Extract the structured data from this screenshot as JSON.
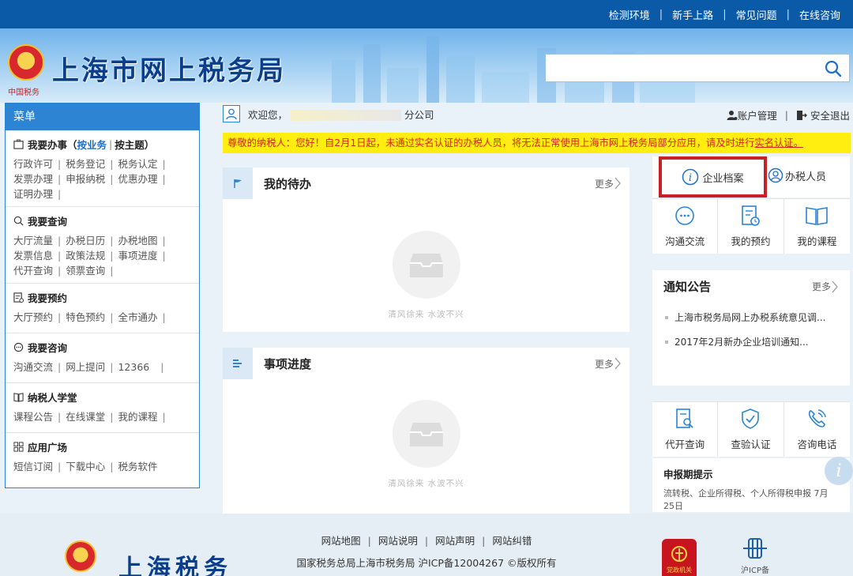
{
  "topnav": {
    "items": [
      "检测环境",
      "新手上路",
      "常见问题",
      "在线咨询"
    ]
  },
  "header": {
    "title": "上海市网上税务局",
    "emblem_text": "中国税务"
  },
  "sidebar": {
    "menu_title": "菜单",
    "sections": [
      {
        "title": "我要办事",
        "title_extra_a": "按业务",
        "title_extra_b": "按主题",
        "rows": [
          [
            "行政许可",
            "税务登记",
            "税务认定"
          ],
          [
            "发票办理",
            "申报纳税",
            "优惠办理"
          ],
          [
            "证明办理"
          ]
        ]
      },
      {
        "title": "我要查询",
        "rows": [
          [
            "大厅流量",
            "办税日历",
            "办税地图"
          ],
          [
            "发票信息",
            "政策法规",
            "事项进度"
          ],
          [
            "代开查询",
            "领票查询"
          ]
        ]
      },
      {
        "title": "我要预约",
        "rows": [
          [
            "大厅预约",
            "特色预约",
            "全市通办"
          ]
        ]
      },
      {
        "title": "我要咨询",
        "rows": [
          [
            "沟通交流",
            "网上提问",
            "12366"
          ]
        ]
      },
      {
        "title": "纳税人学堂",
        "rows": [
          [
            "课程公告",
            "在线课堂",
            "我的课程"
          ]
        ]
      },
      {
        "title": "应用广场",
        "rows": [
          [
            "短信订阅",
            "下载中心",
            "税务软件"
          ]
        ]
      }
    ]
  },
  "welcome": {
    "prefix": "欢迎您，",
    "company_suffix": "分公司",
    "account": "账户管理",
    "logout": "安全退出"
  },
  "notice_bar": {
    "text": "尊敬的纳税人：您好！自2月1日起，未通过实名认证的办税人员，将无法正常使用上海市网上税务局部分应用，请及时进行",
    "link": "实名认证。"
  },
  "todo": {
    "title": "我的待办",
    "more": "更多",
    "empty": "清风徐来  水波不兴"
  },
  "progress": {
    "title": "事项进度",
    "more": "更多",
    "empty": "清风徐来  水波不兴"
  },
  "tabs": {
    "active": "企业档案",
    "other": "办税人员"
  },
  "quick": [
    {
      "label": "沟通交流",
      "icon": "chat-icon"
    },
    {
      "label": "我的预约",
      "icon": "appointment-icon"
    },
    {
      "label": "我的课程",
      "icon": "book-icon"
    }
  ],
  "announce": {
    "title": "通知公告",
    "more": "更多",
    "items": [
      "上海市税务局网上办税系统意见调...",
      "2017年2月新办企业培训通知..."
    ]
  },
  "quick2": [
    {
      "label": "代开查询",
      "icon": "invoice-search-icon"
    },
    {
      "label": "查验认证",
      "icon": "shield-check-icon"
    },
    {
      "label": "咨询电话",
      "icon": "phone-icon"
    }
  ],
  "remind": {
    "title": "申报期提示",
    "body": "流转税、企业所得税、个人所得税申报 7月25日"
  },
  "footer": {
    "links": [
      "网站地图",
      "网站说明",
      "网站声明",
      "网站纠错"
    ],
    "icp": "国家税务总局上海市税务局 沪ICP备12004267 ©版权所有",
    "logo_text": "上海税务",
    "badge_red": "党政机关",
    "badge_icp": "沪ICP备"
  },
  "colors": {
    "topbar": "#0a5aa8",
    "accent": "#2c84d2",
    "notice_bg": "#ffee0f",
    "notice_text": "#d4251d",
    "highlight_border": "#c62127"
  }
}
